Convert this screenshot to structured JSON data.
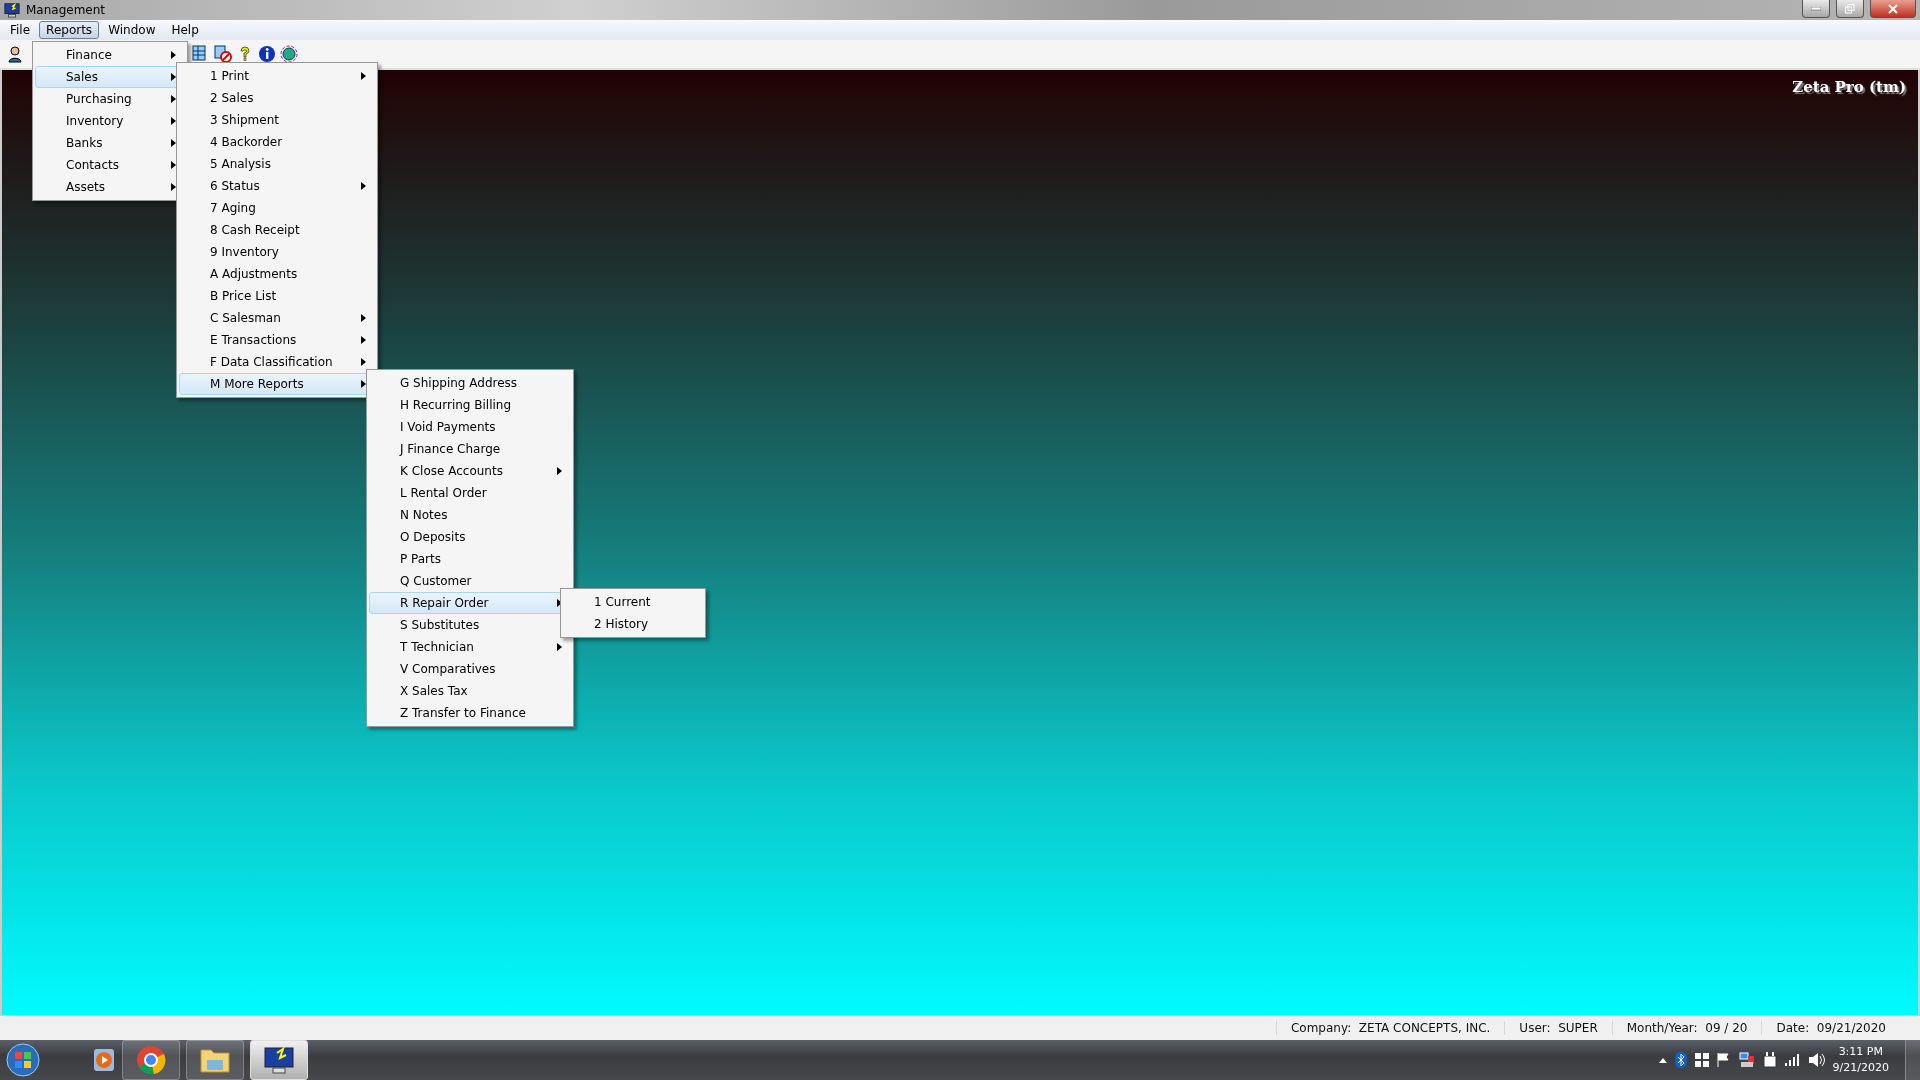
{
  "window": {
    "title": "Management"
  },
  "menubar": [
    {
      "label": "File",
      "selected": false
    },
    {
      "label": "Reports",
      "selected": true
    },
    {
      "label": "Window",
      "selected": false
    },
    {
      "label": "Help",
      "selected": false
    }
  ],
  "open_menus": [
    {
      "items": [
        {
          "label": "Finance",
          "submenu": true,
          "selected": false
        },
        {
          "label": "Sales",
          "submenu": true,
          "selected": true
        },
        {
          "label": "Purchasing",
          "submenu": true,
          "selected": false
        },
        {
          "label": "Inventory",
          "submenu": true,
          "selected": false
        },
        {
          "label": "Banks",
          "submenu": true,
          "selected": false
        },
        {
          "label": "Contacts",
          "submenu": true,
          "selected": false
        },
        {
          "label": "Assets",
          "submenu": true,
          "selected": false
        }
      ]
    },
    {
      "items": [
        {
          "label": "1 Print",
          "submenu": true,
          "selected": false
        },
        {
          "label": "2 Sales",
          "submenu": false,
          "selected": false
        },
        {
          "label": "3 Shipment",
          "submenu": false,
          "selected": false
        },
        {
          "label": "4 Backorder",
          "submenu": false,
          "selected": false
        },
        {
          "label": "5 Analysis",
          "submenu": false,
          "selected": false
        },
        {
          "label": "6 Status",
          "submenu": true,
          "selected": false
        },
        {
          "label": "7 Aging",
          "submenu": false,
          "selected": false
        },
        {
          "label": "8 Cash Receipt",
          "submenu": false,
          "selected": false
        },
        {
          "label": "9 Inventory",
          "submenu": false,
          "selected": false
        },
        {
          "label": "A Adjustments",
          "submenu": false,
          "selected": false
        },
        {
          "label": "B Price List",
          "submenu": false,
          "selected": false
        },
        {
          "label": "C Salesman",
          "submenu": true,
          "selected": false
        },
        {
          "label": "E Transactions",
          "submenu": true,
          "selected": false
        },
        {
          "label": "F Data Classification",
          "submenu": true,
          "selected": false
        },
        {
          "label": "M More Reports",
          "submenu": true,
          "selected": true
        }
      ]
    },
    {
      "items": [
        {
          "label": "G Shipping Address",
          "submenu": false,
          "selected": false
        },
        {
          "label": "H Recurring Billing",
          "submenu": false,
          "selected": false
        },
        {
          "label": "I Void Payments",
          "submenu": false,
          "selected": false
        },
        {
          "label": "J Finance Charge",
          "submenu": false,
          "selected": false
        },
        {
          "label": "K Close Accounts",
          "submenu": true,
          "selected": false
        },
        {
          "label": "L Rental Order",
          "submenu": false,
          "selected": false
        },
        {
          "label": "N Notes",
          "submenu": false,
          "selected": false
        },
        {
          "label": "O Deposits",
          "submenu": false,
          "selected": false
        },
        {
          "label": "P Parts",
          "submenu": false,
          "selected": false
        },
        {
          "label": "Q Customer",
          "submenu": false,
          "selected": false
        },
        {
          "label": "R Repair Order",
          "submenu": true,
          "selected": true
        },
        {
          "label": "S Substitutes",
          "submenu": false,
          "selected": false
        },
        {
          "label": "T Technician",
          "submenu": true,
          "selected": false
        },
        {
          "label": "V Comparatives",
          "submenu": false,
          "selected": false
        },
        {
          "label": "X Sales Tax",
          "submenu": false,
          "selected": false
        },
        {
          "label": "Z Transfer to Finance",
          "submenu": false,
          "selected": false
        }
      ]
    },
    {
      "items": [
        {
          "label": "1 Current",
          "submenu": false,
          "selected": false
        },
        {
          "label": "2 History",
          "submenu": false,
          "selected": false
        }
      ]
    }
  ],
  "brand": "Zeta Pro (tm)",
  "status_bar": [
    {
      "label": "Company:",
      "value": "ZETA CONCEPTS, INC."
    },
    {
      "label": "User:",
      "value": "SUPER"
    },
    {
      "label": "Month/Year:",
      "value": "09 / 20"
    },
    {
      "label": "Date:",
      "value": "09/21/2020"
    }
  ],
  "taskbar": {
    "time": "3:11 PM",
    "date": "9/21/2020"
  }
}
